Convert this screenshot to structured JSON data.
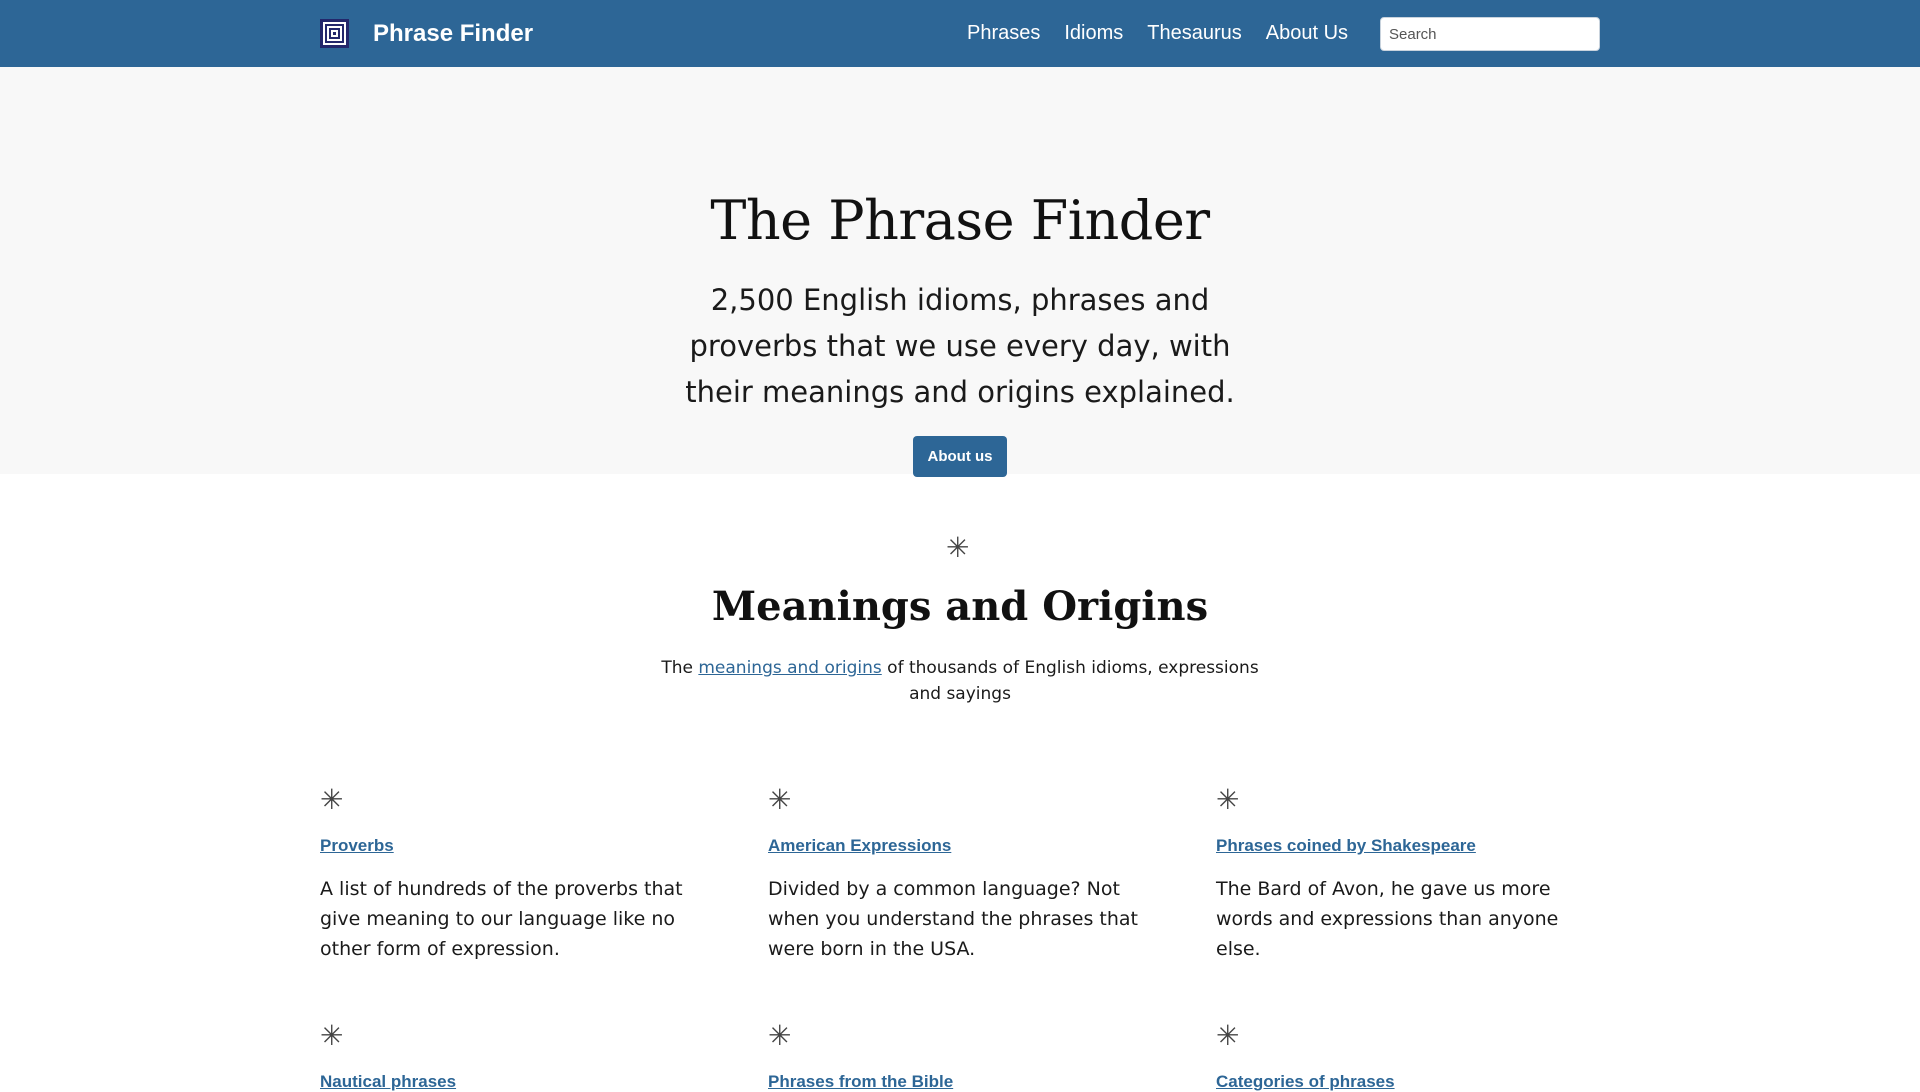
{
  "header": {
    "brand": "Phrase Finder",
    "nav": [
      "Phrases",
      "Idioms",
      "Thesaurus",
      "About Us"
    ],
    "search_placeholder": "Search",
    "accent_color": "#2d6696"
  },
  "hero": {
    "title": "The Phrase Finder",
    "subtitle": "2,500 English idioms, phrases and proverbs that we use every day, with their meanings and origins explained.",
    "button_label": "About us"
  },
  "section": {
    "icon": "asterisk-icon",
    "title": "Meanings and Origins",
    "desc_before": "The ",
    "desc_link": "meanings and origins",
    "desc_after": " of thousands of English idioms, expressions and sayings"
  },
  "cards": [
    {
      "title": "Proverbs",
      "text": "A list of hundreds of the proverbs that give meaning to our language like no other form of expression."
    },
    {
      "title": "American Expressions",
      "text": "Divided by a common language? Not when you understand the phrases that were born in the USA."
    },
    {
      "title": "Phrases coined by Shakespeare",
      "text": "The Bard of Avon, he gave us more words and expressions than anyone else."
    },
    {
      "title": "Nautical phrases",
      "text": ""
    },
    {
      "title": "Phrases from the Bible",
      "text": ""
    },
    {
      "title": "Categories of phrases",
      "text": ""
    }
  ]
}
